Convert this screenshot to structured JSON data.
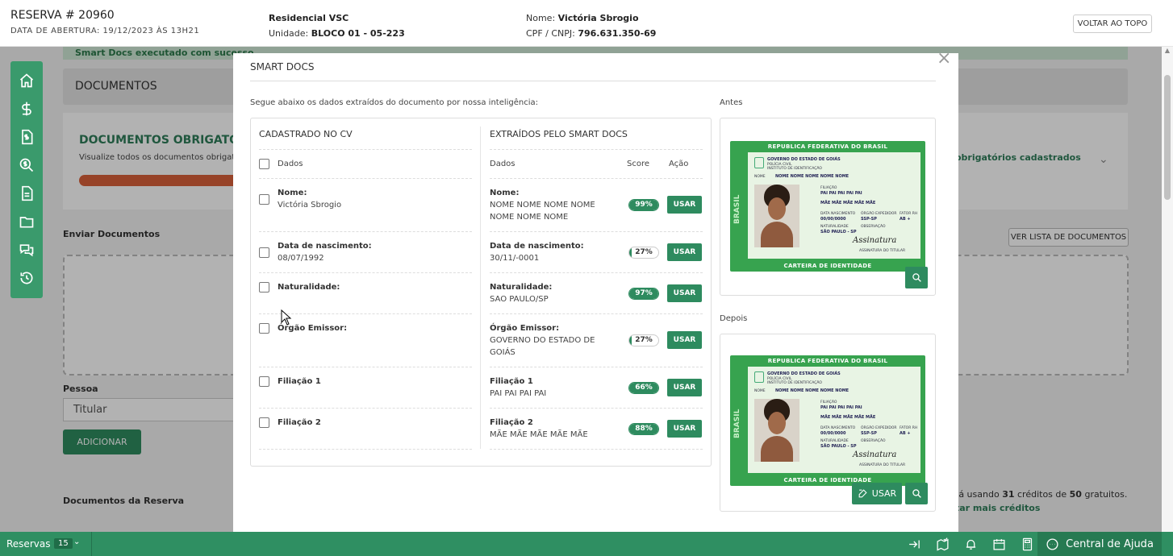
{
  "header": {
    "reserva": "RESERVA # 20960",
    "data_abertura": "DATA DE ABERTURA: 19/12/2023 ÀS 13H21",
    "empreendimento": "Residencial VSC",
    "unidade_label": "Unidade:",
    "unidade": "BLOCO 01 - 05-223",
    "nome_label": "Nome:",
    "nome": "Victória Sbrogio",
    "cpf_label": "CPF / CNPJ:",
    "cpf": "796.631.350-69",
    "voltar_topo": "VOLTAR AO TOPO"
  },
  "background": {
    "notice": "Smart Docs executado com sucesso",
    "documentos": "DOCUMENTOS",
    "obrigatorios_title": "DOCUMENTOS OBRIGATÓRIOS",
    "obrigatorios_sub": "Visualize todos os documentos obrigat",
    "obrigatorios_right": "obrigatórios cadastrados",
    "enviar": "Enviar Documentos",
    "ver_lista": "VER LISTA DE DOCUMENTOS",
    "pessoa_label": "Pessoa",
    "pessoa_value": "Titular",
    "adicionar": "ADICIONAR",
    "docs_reserva": "Documentos da Reserva",
    "creditos_pre": "tá usando ",
    "creditos_used": "31",
    "creditos_mid": " créditos de ",
    "creditos_total": "50",
    "creditos_post": " gratuitos.",
    "mais_creditos": "tar mais créditos"
  },
  "modal": {
    "title": "SMART DOCS",
    "intro": "Segue abaixo os dados extraídos do documento por nossa inteligência:",
    "antes": "Antes",
    "depois": "Depois",
    "left_header": "CADASTRADO NO CV",
    "right_header": "EXTRAÍDOS PELO SMART DOCS",
    "dados": "Dados",
    "score": "Score",
    "acao": "Ação",
    "usar": "USAR",
    "rows": [
      {
        "label": "Nome:",
        "cv_value": "Victória Sbrogio",
        "smart_label": "Nome:",
        "smart_value": "NOME NOME NOME NOME NOME NOME NOME",
        "score": "99%",
        "score_pct": 99
      },
      {
        "label": "Data de nascimento:",
        "cv_value": "08/07/1992",
        "smart_label": "Data de nascimento:",
        "smart_value": "30/11/-0001",
        "score": "27%",
        "score_pct": 27
      },
      {
        "label": "Naturalidade:",
        "cv_value": "",
        "smart_label": "Naturalidade:",
        "smart_value": "SAO PAULO/SP",
        "score": "97%",
        "score_pct": 97
      },
      {
        "label": "Órgão Emissor:",
        "cv_value": "",
        "smart_label": "Órgão Emissor:",
        "smart_value": "GOVERNO DO ESTADO DE GOIÁS",
        "score": "27%",
        "score_pct": 27
      },
      {
        "label": "Filiação 1",
        "cv_value": "",
        "smart_label": "Filiação 1",
        "smart_value": "PAI PAI PAI PAI",
        "score": "66%",
        "score_pct": 66
      },
      {
        "label": "Filiação 2",
        "cv_value": "",
        "smart_label": "Filiação 2",
        "smart_value": "MÃE MÃE MÃE MÃE MÃE",
        "score": "88%",
        "score_pct": 88
      }
    ],
    "card": {
      "top": "REPUBLICA FEDERATIVA DO BRASIL",
      "bottom": "CARTEIRA DE IDENTIDADE",
      "side": "BRASIL",
      "gov": "GOVERNO DO ESTADO DE GOIÁS",
      "gov_sub1": "POLÍCIA CIVIL",
      "gov_sub2": "INSTITUTO DE IDENTIFICAÇÃO",
      "nome_label": "NOME",
      "nome": "NOME NOME NOME NOME NOME",
      "filiacao_label": "FILIAÇÃO",
      "pai": "PAI PAI PAI PAI PAI",
      "mae": "MÃE MÃE MÃE MÃE MÃE",
      "nasc_label": "DATA NASCIMENTO",
      "nasc": "00/00/0000",
      "orgao_label": "ÓRGÃO EXPEDIDOR",
      "orgao": "SSP-SP",
      "fator_label": "FATOR RH",
      "fator": "AB +",
      "natural_label": "NATURALIDADE",
      "natural": "SÃO PAULO - SP",
      "obs_label": "OBSERVAÇÃO",
      "sign": "Assinatura",
      "sign_sub": "ASSINATURA DO TITULAR"
    },
    "usar_img": "USAR"
  },
  "bottom": {
    "reservas": "Reservas",
    "count": "15",
    "help": "Central de Ajuda"
  },
  "icons": {
    "sidebar": [
      "home-icon",
      "dollar-icon",
      "invoice-icon",
      "search-dollar-icon",
      "document-icon",
      "folder-icon",
      "chat-icon",
      "history-icon"
    ],
    "bottom": [
      "arrow-right-bar-icon",
      "map-check-icon",
      "bell-icon",
      "calendar-icon",
      "calculator-icon"
    ]
  }
}
